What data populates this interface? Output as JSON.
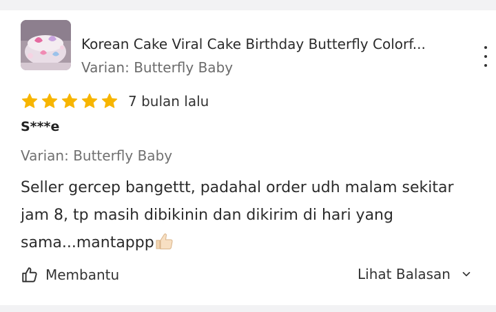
{
  "product": {
    "title": "Korean Cake Viral Cake Birthday Butterfly Colorf...",
    "variant": "Varian: Butterfly Baby",
    "thumbnail_icon": "cake-thumbnail"
  },
  "review": {
    "rating": 5,
    "max_rating": 5,
    "time_ago": "7 bulan lalu",
    "user": "S***e",
    "variant": "Varian: Butterfly Baby",
    "text": "Seller gercep bangettt, padahal order udh malam sekitar jam 8, tp masih dibikinin dan dikirim di hari yang sama...mantappp",
    "text_emoji": "thumbs-up-emoji"
  },
  "actions": {
    "helpful_label": "Membantu",
    "replies_label": "Lihat Balasan"
  },
  "colors": {
    "star": "#f7b500",
    "background": "#f2f2f4",
    "card": "#ffffff"
  }
}
